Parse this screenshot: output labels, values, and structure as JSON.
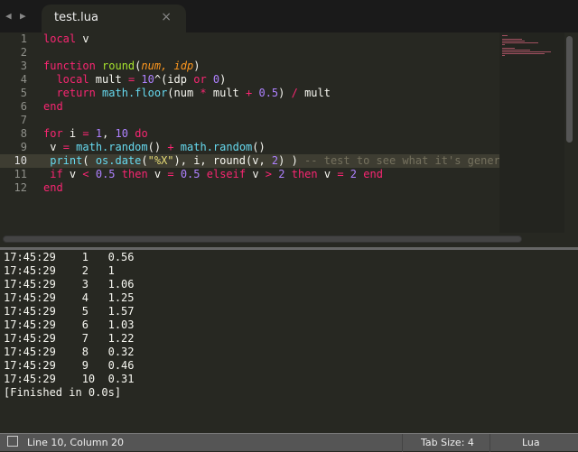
{
  "tab": {
    "title": "test.lua",
    "close": "×",
    "back": "◀",
    "forward": "▶"
  },
  "editor": {
    "current_line": 10,
    "lines": [
      [
        [
          "local",
          "kw"
        ],
        [
          " v",
          ""
        ]
      ],
      [],
      [
        [
          "function",
          "kw"
        ],
        [
          " ",
          ""
        ],
        [
          "round",
          "fn"
        ],
        [
          "(",
          ""
        ],
        [
          "num",
          "pa"
        ],
        [
          ", ",
          "pa"
        ],
        [
          "idp",
          "pa"
        ],
        [
          ")",
          ""
        ]
      ],
      [
        [
          "  ",
          ""
        ],
        [
          "local",
          "kw"
        ],
        [
          " mult ",
          ""
        ],
        [
          "=",
          "op"
        ],
        [
          " ",
          ""
        ],
        [
          "10",
          "nu"
        ],
        [
          "^(idp ",
          ""
        ],
        [
          "or",
          "kw"
        ],
        [
          " ",
          ""
        ],
        [
          "0",
          "nu"
        ],
        [
          ")",
          ""
        ]
      ],
      [
        [
          "  ",
          ""
        ],
        [
          "return",
          "kw"
        ],
        [
          " ",
          ""
        ],
        [
          "math.floor",
          "bi"
        ],
        [
          "(num ",
          ""
        ],
        [
          "*",
          "op"
        ],
        [
          " mult ",
          ""
        ],
        [
          "+",
          "op"
        ],
        [
          " ",
          ""
        ],
        [
          "0.5",
          "nu"
        ],
        [
          ") ",
          ""
        ],
        [
          "/",
          "op"
        ],
        [
          " mult",
          ""
        ]
      ],
      [
        [
          "end",
          "kw"
        ]
      ],
      [],
      [
        [
          "for",
          "kw"
        ],
        [
          " i ",
          ""
        ],
        [
          "=",
          "op"
        ],
        [
          " ",
          ""
        ],
        [
          "1",
          "nu"
        ],
        [
          ", ",
          ""
        ],
        [
          "10",
          "nu"
        ],
        [
          " ",
          ""
        ],
        [
          "do",
          "kw"
        ]
      ],
      [
        [
          " v ",
          ""
        ],
        [
          "=",
          "op"
        ],
        [
          " ",
          ""
        ],
        [
          "math.random",
          "bi"
        ],
        [
          "() ",
          ""
        ],
        [
          "+",
          "op"
        ],
        [
          " ",
          ""
        ],
        [
          "math.random",
          "bi"
        ],
        [
          "()",
          ""
        ]
      ],
      [
        [
          " ",
          ""
        ],
        [
          "print",
          "bi"
        ],
        [
          "( ",
          ""
        ],
        [
          "os.date",
          "bi"
        ],
        [
          "(",
          ""
        ],
        [
          "\"%X\"",
          "st"
        ],
        [
          "), i, round(v, ",
          ""
        ],
        [
          "2",
          "nu"
        ],
        [
          ") ) ",
          ""
        ],
        [
          "-- test to see what it's generat",
          "cm"
        ]
      ],
      [
        [
          " ",
          ""
        ],
        [
          "if",
          "kw"
        ],
        [
          " v ",
          ""
        ],
        [
          "<",
          "op"
        ],
        [
          " ",
          ""
        ],
        [
          "0.5",
          "nu"
        ],
        [
          " ",
          ""
        ],
        [
          "then",
          "kw"
        ],
        [
          " v ",
          ""
        ],
        [
          "=",
          "op"
        ],
        [
          " ",
          ""
        ],
        [
          "0.5",
          "nu"
        ],
        [
          " ",
          ""
        ],
        [
          "elseif",
          "kw"
        ],
        [
          " v ",
          ""
        ],
        [
          ">",
          "op"
        ],
        [
          " ",
          ""
        ],
        [
          "2",
          "nu"
        ],
        [
          " ",
          ""
        ],
        [
          "then",
          "kw"
        ],
        [
          " v ",
          ""
        ],
        [
          "=",
          "op"
        ],
        [
          " ",
          ""
        ],
        [
          "2",
          "nu"
        ],
        [
          " ",
          ""
        ],
        [
          "end",
          "kw"
        ]
      ],
      [
        [
          "end",
          "kw"
        ]
      ]
    ]
  },
  "output": [
    "17:45:29    1   0.56",
    "17:45:29    2   1",
    "17:45:29    3   1.06",
    "17:45:29    4   1.25",
    "17:45:29    5   1.57",
    "17:45:29    6   1.03",
    "17:45:29    7   1.22",
    "17:45:29    8   0.32",
    "17:45:29    9   0.46",
    "17:45:29    10  0.31",
    "[Finished in 0.0s]"
  ],
  "status": {
    "position": "Line 10, Column 20",
    "tab_size": "Tab Size: 4",
    "syntax": "Lua"
  }
}
